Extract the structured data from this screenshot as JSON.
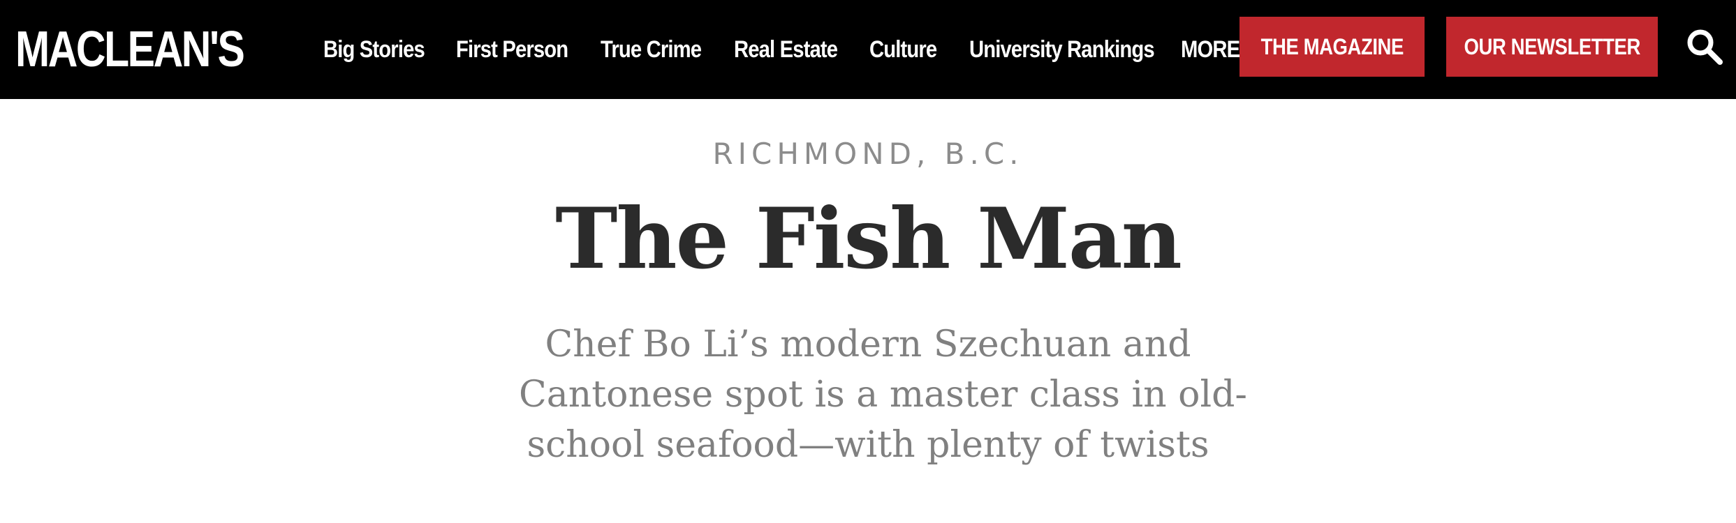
{
  "header": {
    "logo": "MACLEAN'S",
    "nav": [
      {
        "label": "Big Stories"
      },
      {
        "label": "First Person"
      },
      {
        "label": "True Crime"
      },
      {
        "label": "Real Estate"
      },
      {
        "label": "Culture"
      },
      {
        "label": "University Rankings"
      },
      {
        "label": "MORE"
      }
    ],
    "magazine_button": "THE MAGAZINE",
    "newsletter_button": "OUR NEWSLETTER",
    "search_icon": "search-icon"
  },
  "article": {
    "kicker": "RICHMOND, B.C.",
    "title": "The Fish Man",
    "dek_lines": [
      "Chef Bo Li’s modern Szechuan and",
      "Cantonese spot is a master class in old-",
      "school seafood—with plenty of twists"
    ]
  },
  "colors": {
    "topbar": "#000000",
    "accent_red": "#c1272d",
    "kicker_gray": "#8c8c8c",
    "title_dark": "#2b2b2b",
    "dek_gray": "#808080"
  }
}
